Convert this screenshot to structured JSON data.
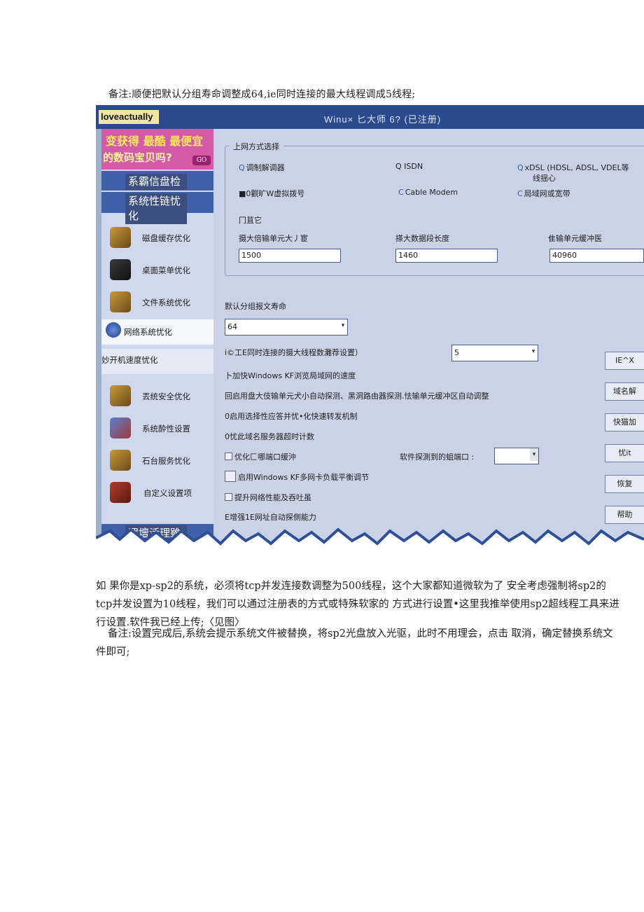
{
  "note1": "备注:顺便把默认分组寿命调整成64,ie同时连接的最大线程调成5线程;",
  "para2": "如 果你是xp-sp2的系统，必须将tcp并发连接数调整为500线程，这个大家都知道微软为了 安全考虑强制将sp2的tcp并发设置为10线程，我们可以通过注册表的方式或特殊软家的 方式进行设置•这里我推举使用sp2超线程工具来进行设置.软件我已经上传;〈见图〉",
  "para3": "备注:设置完成后,系统会提示系统文件被替换，将sp2光盘放入光驱，此时不用理会，点击 取消，确定替换系统文件即可;",
  "app": {
    "label": "loveactually",
    "title": "Winu×     匕大师     6?  (已注册)",
    "banner_line1": "变获得 最酷 最便宜",
    "banner_line2": "的数码宝贝吗?",
    "banner_go": "GO",
    "sidebar_headers": [
      "系霸信盘检",
      "系统性链忧化",
      "罢壇活理雖护"
    ],
    "sidebar_items": [
      "磁盘缓存优化",
      "桌面菜单优化",
      "文件系统优化",
      "网络系统忧化",
      "妙开机速度忧化",
      "丟统安全优化",
      "系统酔性设置",
      "石台服务忧化",
      "自定义设置项"
    ],
    "group_title": "上网方式选择",
    "options": {
      "modem": "调制解调器",
      "isdn": "Q ISDN",
      "xdsl": "xDSL (HDSL, ADSL, VDEL等",
      "xdsl_line2": "线揺心",
      "vdial": "■0觀旷W虚拟拨号",
      "cable": "Cable Modem",
      "lan": "局域网或宽带",
      "other": "冂苴它",
      "mark_q": "Q",
      "mark_c": "C"
    },
    "fields": {
      "mtu_label": "摄大倍输单元大丿宦",
      "mtu_value": "1500",
      "mss_label": "搽大数据段长度",
      "mss_value": "1460",
      "rwin_label": "隹输单元缓冲医",
      "rwin_value": "40960",
      "ttl_label": "默认分组报文寿命",
      "ttl_value": "64",
      "ie_label": "i©工E同时连接的摄大线程数灘荐设置）",
      "ie_value": "5",
      "arrow": "▾"
    },
    "checks": [
      "卜加快Windows KF浏览局域网的速度",
      "回启用盘大伎输单元犬小自动探测、黑洞路由器探测.怯输单元缓冲区自动调整",
      "0启用选择性应答并忧•化快速转发机制",
      "0忧此域名服务器超时计数",
      "优化匚哪端口缓沖",
      "启用Windows KF多网卡负载平衡调节",
      "提升网络性能及吞吐虽",
      "E增强1E网址自动探側能力"
    ],
    "port_label": "软件探測到的蛆端口 :",
    "buttons": [
      "IE^X",
      "域名解",
      "快猫加",
      "忧it",
      "恢复",
      "帮助"
    ]
  }
}
